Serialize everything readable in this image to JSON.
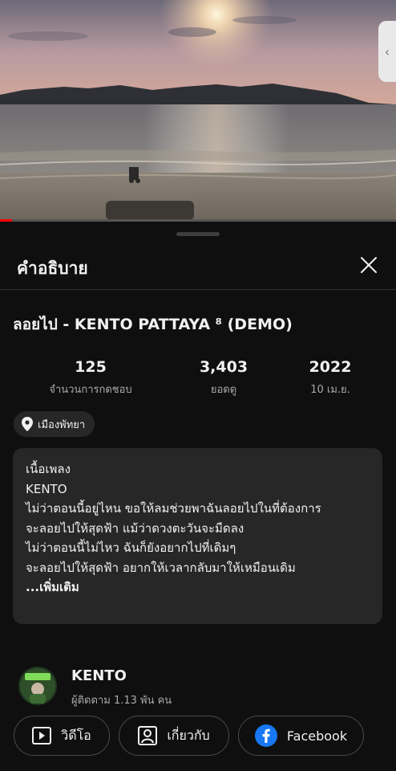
{
  "video": {
    "side_handle_glyph": "‹",
    "progress": 0.03,
    "colors": {
      "progress": "#ff0000"
    }
  },
  "panel": {
    "title": "คำอธิบาย",
    "close_icon": "close-icon"
  },
  "video_title": "ลอยไป - KENTO PATTAYA ⁸ (DEMO)",
  "stats": [
    {
      "value": "125",
      "label": "จำนวนการกดชอบ"
    },
    {
      "value": "3,403",
      "label": "ยอดดู"
    },
    {
      "value": "2022",
      "label": "10 เม.ย."
    }
  ],
  "location": {
    "label": "เมืองพัทยา",
    "icon": "location-pin-icon"
  },
  "description": {
    "lines": [
      "เนื้อเพลง",
      "KENTO",
      "ไม่ว่าตอนนี้อยู่ไหน ขอให้ลมช่วยพาฉันลอยไปในที่ต้องการ",
      "จะลอยไปให้สุดฟ้า แม้ว่าดวงตะวันจะมืดลง",
      "ไม่ว่าตอนนี้ไม่ไหว ฉันก็ยังอยากไปที่เดิมๆ",
      "จะลอยไปให้สุดฟ้า อยากให้เวลากลับมาให้เหมือนเดิม"
    ],
    "more": "...เพิ่มเติม"
  },
  "channel": {
    "name": "KENTO",
    "subscribers": "ผู้ติดตาม 1.13 พัน คน"
  },
  "buttons": {
    "videos": "วิดีโอ",
    "about": "เกี่ยวกับ",
    "facebook": "Facebook",
    "facebook_color": "#1877f2"
  }
}
